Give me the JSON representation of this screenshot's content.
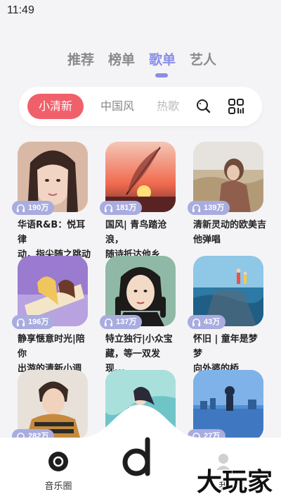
{
  "status": {
    "time": "11:49"
  },
  "top_tabs": [
    {
      "label": "推荐"
    },
    {
      "label": "榜单"
    },
    {
      "label": "歌单"
    },
    {
      "label": "艺人"
    }
  ],
  "active_top_tab": "歌单",
  "filters": [
    {
      "label": "小清新",
      "active": true
    },
    {
      "label": "中国风"
    },
    {
      "label": "热歌"
    }
  ],
  "playlists": [
    {
      "plays": "190万",
      "title": "华语R&B：悦耳律\n动，指尖随之跳动"
    },
    {
      "plays": "181万",
      "title": "国风| 青鸟踏沧浪，\n随诗抵达他乡"
    },
    {
      "plays": "139万",
      "title": "清新灵动的欧美吉\n他弹唱"
    },
    {
      "plays": "196万",
      "title": "静享惬意时光|陪你\n出游的清新小调"
    },
    {
      "plays": "137万",
      "title": "特立独行|小众宝\n藏，等一双发现..."
    },
    {
      "plays": "43万",
      "title": "怀旧 | 童年是梦 梦\n向外婆的桥"
    },
    {
      "plays": "282万",
      "title": ""
    },
    {
      "plays": "",
      "title": ""
    },
    {
      "plays": "27万",
      "title": ""
    }
  ],
  "bottom_nav": {
    "left_label": "音乐圈",
    "right_label_partial": "我"
  },
  "watermark_text": "大玩家",
  "colors": {
    "accent": "#8a8ee6",
    "chip_active": "#f0606b",
    "badge": "#a9acdf"
  }
}
